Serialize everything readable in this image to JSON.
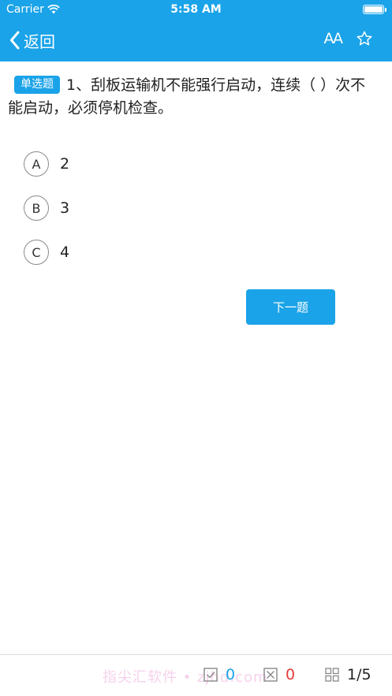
{
  "status_bar": {
    "carrier": "Carrier",
    "time": "5:58 AM"
  },
  "nav": {
    "back_label": "返回",
    "font_icon_label": "AA"
  },
  "question": {
    "type_badge": "单选题",
    "text": "1、刮板运输机不能强行启动，连续（ ）次不能启动，必须停机检查。"
  },
  "options": [
    {
      "letter": "A",
      "text": "2"
    },
    {
      "letter": "B",
      "text": "3"
    },
    {
      "letter": "C",
      "text": "4"
    }
  ],
  "next_button": "下一题",
  "bottom": {
    "watermark": "指尖汇软件 • zjhd.com",
    "correct_count": "0",
    "wrong_count": "0",
    "progress": "1/5"
  },
  "colors": {
    "accent": "#1aa3e8",
    "wrong": "#e83b3b"
  },
  "icons": [
    "wifi-icon",
    "battery-icon",
    "back-chevron-icon",
    "font-size-icon",
    "star-icon",
    "correct-checkbox-icon",
    "wrong-checkbox-icon",
    "grid-icon"
  ]
}
